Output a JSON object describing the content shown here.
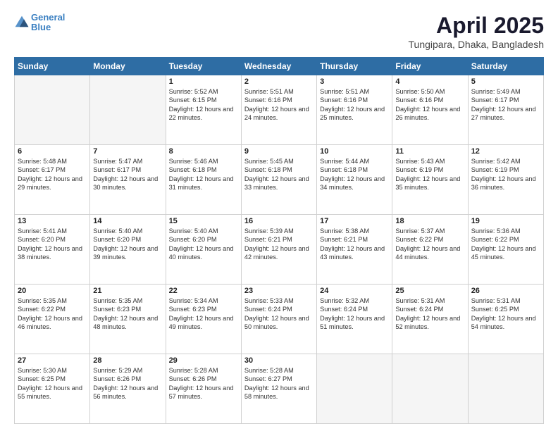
{
  "header": {
    "logo_line1": "General",
    "logo_line2": "Blue",
    "title": "April 2025",
    "subtitle": "Tungipara, Dhaka, Bangladesh"
  },
  "days_of_week": [
    "Sunday",
    "Monday",
    "Tuesday",
    "Wednesday",
    "Thursday",
    "Friday",
    "Saturday"
  ],
  "weeks": [
    [
      {
        "num": "",
        "sunrise": "",
        "sunset": "",
        "daylight": "",
        "empty": true
      },
      {
        "num": "",
        "sunrise": "",
        "sunset": "",
        "daylight": "",
        "empty": true
      },
      {
        "num": "1",
        "sunrise": "Sunrise: 5:52 AM",
        "sunset": "Sunset: 6:15 PM",
        "daylight": "Daylight: 12 hours and 22 minutes."
      },
      {
        "num": "2",
        "sunrise": "Sunrise: 5:51 AM",
        "sunset": "Sunset: 6:16 PM",
        "daylight": "Daylight: 12 hours and 24 minutes."
      },
      {
        "num": "3",
        "sunrise": "Sunrise: 5:51 AM",
        "sunset": "Sunset: 6:16 PM",
        "daylight": "Daylight: 12 hours and 25 minutes."
      },
      {
        "num": "4",
        "sunrise": "Sunrise: 5:50 AM",
        "sunset": "Sunset: 6:16 PM",
        "daylight": "Daylight: 12 hours and 26 minutes."
      },
      {
        "num": "5",
        "sunrise": "Sunrise: 5:49 AM",
        "sunset": "Sunset: 6:17 PM",
        "daylight": "Daylight: 12 hours and 27 minutes."
      }
    ],
    [
      {
        "num": "6",
        "sunrise": "Sunrise: 5:48 AM",
        "sunset": "Sunset: 6:17 PM",
        "daylight": "Daylight: 12 hours and 29 minutes."
      },
      {
        "num": "7",
        "sunrise": "Sunrise: 5:47 AM",
        "sunset": "Sunset: 6:17 PM",
        "daylight": "Daylight: 12 hours and 30 minutes."
      },
      {
        "num": "8",
        "sunrise": "Sunrise: 5:46 AM",
        "sunset": "Sunset: 6:18 PM",
        "daylight": "Daylight: 12 hours and 31 minutes."
      },
      {
        "num": "9",
        "sunrise": "Sunrise: 5:45 AM",
        "sunset": "Sunset: 6:18 PM",
        "daylight": "Daylight: 12 hours and 33 minutes."
      },
      {
        "num": "10",
        "sunrise": "Sunrise: 5:44 AM",
        "sunset": "Sunset: 6:18 PM",
        "daylight": "Daylight: 12 hours and 34 minutes."
      },
      {
        "num": "11",
        "sunrise": "Sunrise: 5:43 AM",
        "sunset": "Sunset: 6:19 PM",
        "daylight": "Daylight: 12 hours and 35 minutes."
      },
      {
        "num": "12",
        "sunrise": "Sunrise: 5:42 AM",
        "sunset": "Sunset: 6:19 PM",
        "daylight": "Daylight: 12 hours and 36 minutes."
      }
    ],
    [
      {
        "num": "13",
        "sunrise": "Sunrise: 5:41 AM",
        "sunset": "Sunset: 6:20 PM",
        "daylight": "Daylight: 12 hours and 38 minutes."
      },
      {
        "num": "14",
        "sunrise": "Sunrise: 5:40 AM",
        "sunset": "Sunset: 6:20 PM",
        "daylight": "Daylight: 12 hours and 39 minutes."
      },
      {
        "num": "15",
        "sunrise": "Sunrise: 5:40 AM",
        "sunset": "Sunset: 6:20 PM",
        "daylight": "Daylight: 12 hours and 40 minutes."
      },
      {
        "num": "16",
        "sunrise": "Sunrise: 5:39 AM",
        "sunset": "Sunset: 6:21 PM",
        "daylight": "Daylight: 12 hours and 42 minutes."
      },
      {
        "num": "17",
        "sunrise": "Sunrise: 5:38 AM",
        "sunset": "Sunset: 6:21 PM",
        "daylight": "Daylight: 12 hours and 43 minutes."
      },
      {
        "num": "18",
        "sunrise": "Sunrise: 5:37 AM",
        "sunset": "Sunset: 6:22 PM",
        "daylight": "Daylight: 12 hours and 44 minutes."
      },
      {
        "num": "19",
        "sunrise": "Sunrise: 5:36 AM",
        "sunset": "Sunset: 6:22 PM",
        "daylight": "Daylight: 12 hours and 45 minutes."
      }
    ],
    [
      {
        "num": "20",
        "sunrise": "Sunrise: 5:35 AM",
        "sunset": "Sunset: 6:22 PM",
        "daylight": "Daylight: 12 hours and 46 minutes."
      },
      {
        "num": "21",
        "sunrise": "Sunrise: 5:35 AM",
        "sunset": "Sunset: 6:23 PM",
        "daylight": "Daylight: 12 hours and 48 minutes."
      },
      {
        "num": "22",
        "sunrise": "Sunrise: 5:34 AM",
        "sunset": "Sunset: 6:23 PM",
        "daylight": "Daylight: 12 hours and 49 minutes."
      },
      {
        "num": "23",
        "sunrise": "Sunrise: 5:33 AM",
        "sunset": "Sunset: 6:24 PM",
        "daylight": "Daylight: 12 hours and 50 minutes."
      },
      {
        "num": "24",
        "sunrise": "Sunrise: 5:32 AM",
        "sunset": "Sunset: 6:24 PM",
        "daylight": "Daylight: 12 hours and 51 minutes."
      },
      {
        "num": "25",
        "sunrise": "Sunrise: 5:31 AM",
        "sunset": "Sunset: 6:24 PM",
        "daylight": "Daylight: 12 hours and 52 minutes."
      },
      {
        "num": "26",
        "sunrise": "Sunrise: 5:31 AM",
        "sunset": "Sunset: 6:25 PM",
        "daylight": "Daylight: 12 hours and 54 minutes."
      }
    ],
    [
      {
        "num": "27",
        "sunrise": "Sunrise: 5:30 AM",
        "sunset": "Sunset: 6:25 PM",
        "daylight": "Daylight: 12 hours and 55 minutes."
      },
      {
        "num": "28",
        "sunrise": "Sunrise: 5:29 AM",
        "sunset": "Sunset: 6:26 PM",
        "daylight": "Daylight: 12 hours and 56 minutes."
      },
      {
        "num": "29",
        "sunrise": "Sunrise: 5:28 AM",
        "sunset": "Sunset: 6:26 PM",
        "daylight": "Daylight: 12 hours and 57 minutes."
      },
      {
        "num": "30",
        "sunrise": "Sunrise: 5:28 AM",
        "sunset": "Sunset: 6:27 PM",
        "daylight": "Daylight: 12 hours and 58 minutes."
      },
      {
        "num": "",
        "sunrise": "",
        "sunset": "",
        "daylight": "",
        "empty": true
      },
      {
        "num": "",
        "sunrise": "",
        "sunset": "",
        "daylight": "",
        "empty": true
      },
      {
        "num": "",
        "sunrise": "",
        "sunset": "",
        "daylight": "",
        "empty": true
      }
    ]
  ]
}
